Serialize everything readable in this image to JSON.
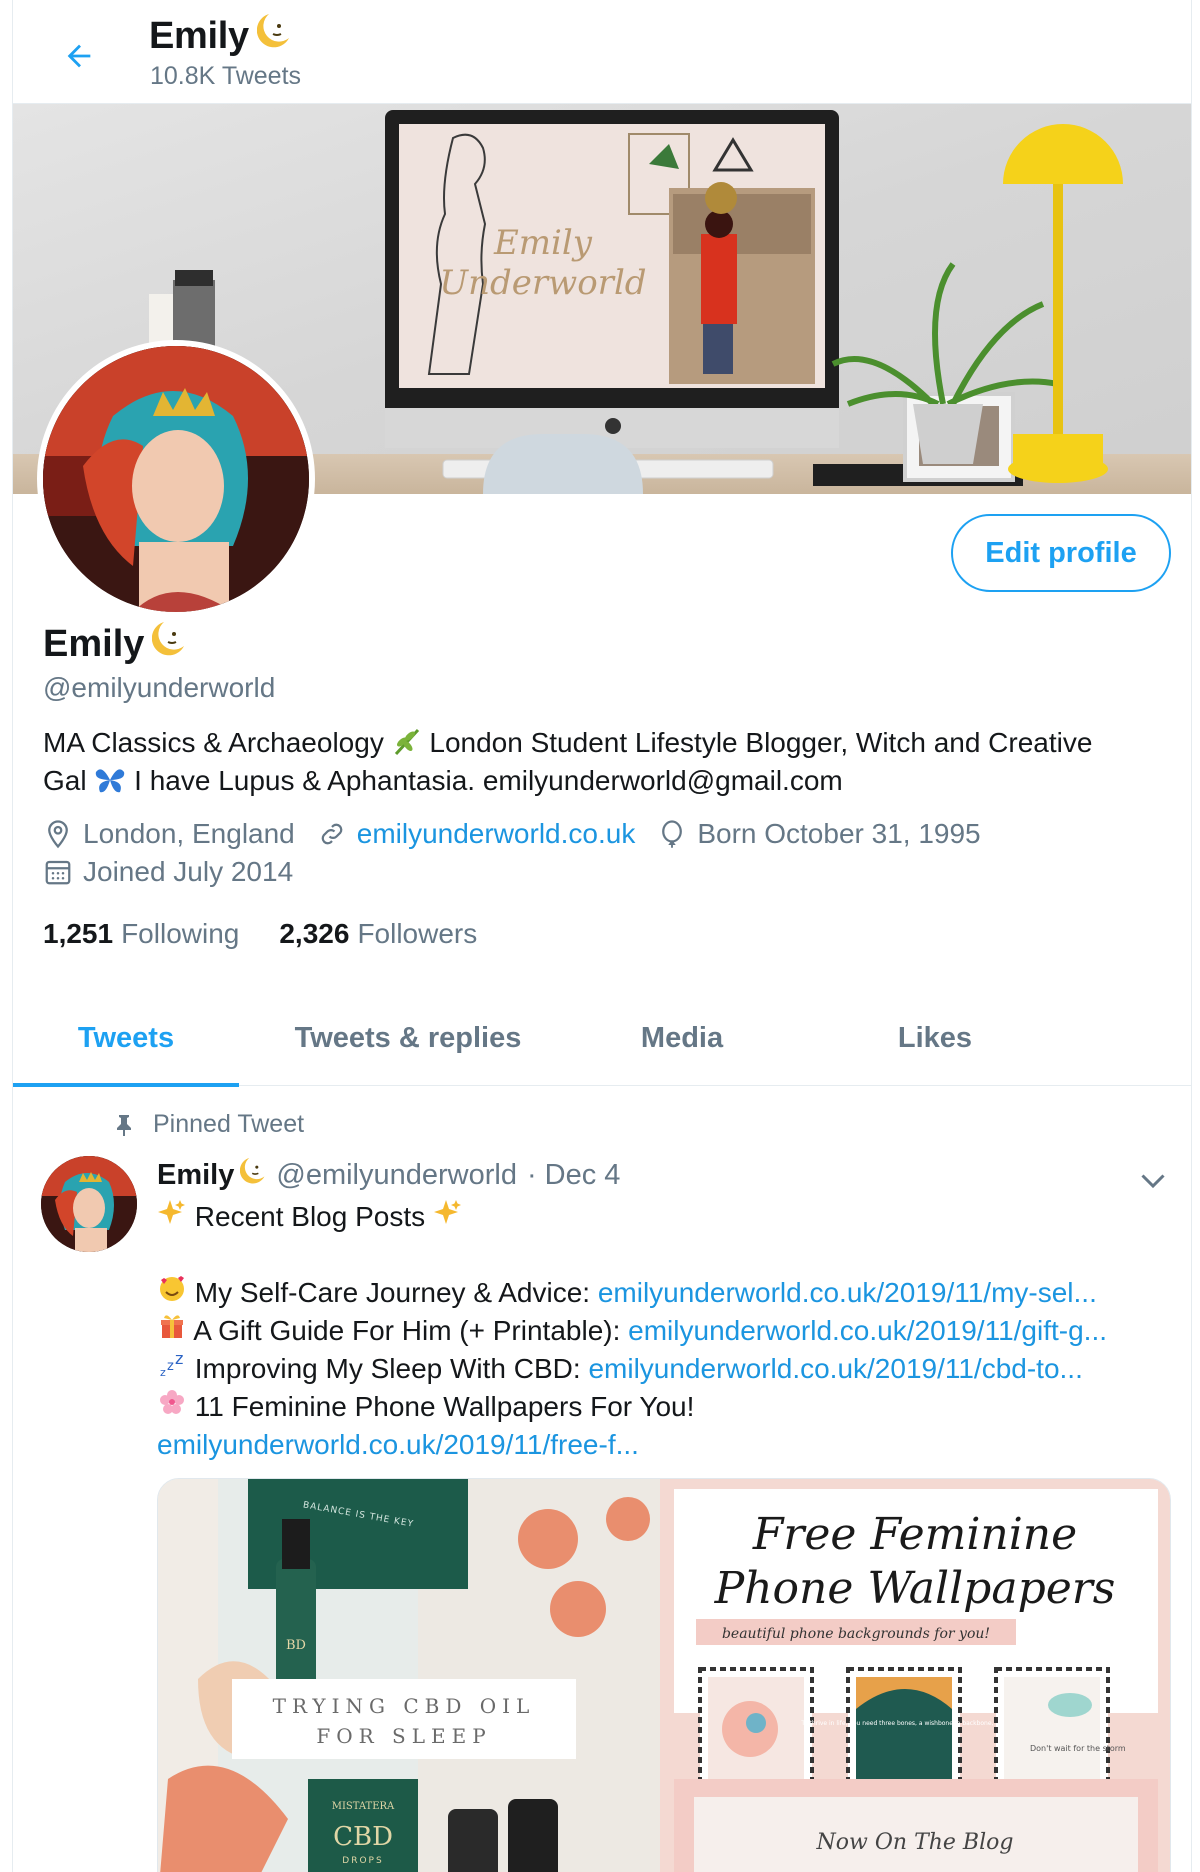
{
  "header": {
    "title": "Emily",
    "tweet_count": "10.8K Tweets",
    "back_icon": "arrow-left-icon"
  },
  "banner": {
    "screen_text_line1": "Emily",
    "screen_text_line2": "Underworld"
  },
  "profile": {
    "name": "Emily",
    "handle": "@emilyunderworld",
    "edit_label": "Edit profile",
    "bio_line1_a": "MA Classics & Archaeology",
    "bio_line1_b": "London Student Lifestyle Blogger, Witch and Creative",
    "bio_line2_a": "Gal",
    "bio_line2_b": "I have Lupus & Aphantasia. emilyunderworld@gmail.com",
    "location": "London, England",
    "website": "emilyunderworld.co.uk",
    "birthday": "Born October 31, 1995",
    "joined": "Joined July 2014",
    "following_count": "1,251",
    "following_label": "Following",
    "followers_count": "2,326",
    "followers_label": "Followers"
  },
  "tabs": [
    {
      "label": "Tweets",
      "active": true
    },
    {
      "label": "Tweets & replies",
      "active": false
    },
    {
      "label": "Media",
      "active": false
    },
    {
      "label": "Likes",
      "active": false
    }
  ],
  "pinned_tweet": {
    "pinned_label": "Pinned Tweet",
    "author_name": "Emily",
    "author_handle": "@emilyunderworld",
    "date": "· Dec 4",
    "title_line": "Recent Blog Posts",
    "items": [
      {
        "text": "My Self-Care Journey & Advice: ",
        "link": "emilyunderworld.co.uk/2019/11/my-sel..."
      },
      {
        "text": "A Gift Guide For Him (+ Printable): ",
        "link": "emilyunderworld.co.uk/2019/11/gift-g..."
      },
      {
        "text": "Improving My Sleep With CBD: ",
        "link": "emilyunderworld.co.uk/2019/11/cbd-to..."
      },
      {
        "text": "11 Feminine Phone Wallpapers For You!",
        "link": ""
      }
    ],
    "last_link": "emilyunderworld.co.uk/2019/11/free-f...",
    "media_left": {
      "box_line1": "TRYING CBD OIL",
      "box_line2": "FOR SLEEP",
      "bottle_top_text": "BALANCE IS THE KEY",
      "bottle_label": "MISTATERA",
      "cbd_text": "CBD",
      "drops_text": "DROPS",
      "bottle_small": "BD"
    },
    "media_right": {
      "title_line1": "Free Feminine",
      "title_line2": "Phone Wallpapers",
      "subtitle": "beautiful phone backgrounds for you!",
      "card2_text": "To thrive in life, you need three bones, a wishbone, a backbone, and",
      "card3_text": "Don't wait for the storm",
      "footer": "Now On The Blog"
    }
  },
  "colors": {
    "accent": "#1da1f2",
    "link": "#1b95e0",
    "muted": "#657786"
  }
}
